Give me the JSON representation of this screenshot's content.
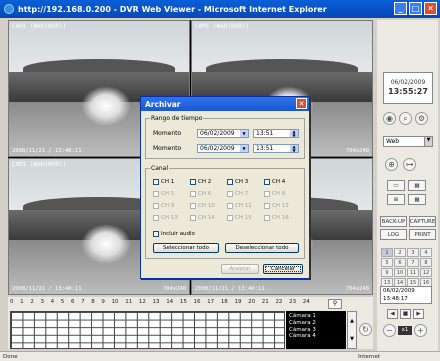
{
  "window": {
    "title": "http://192.168.0.200 - DVR Web Viewer - Microsoft Internet Explorer"
  },
  "cameras": [
    {
      "label": "CAM1 (Web(NVR))",
      "timestamp": "2008/11/21 / 13:40:11",
      "resolution": "704x240"
    },
    {
      "label": "CAM1 (Web(NVR))",
      "timestamp": "",
      "resolution": "704x240"
    },
    {
      "label": "CAM1 (Web(NVR))",
      "timestamp": "2008/11/21 / 13:40:11",
      "resolution": "704x240"
    },
    {
      "label": "",
      "timestamp": "2008/11/21 / 13:40:11",
      "resolution": "704x240"
    }
  ],
  "side": {
    "date": "06/02/2009",
    "time": "13:55:27",
    "mode_select": "Web",
    "backup": "BACK-UP",
    "capture": "CAPTURE",
    "log": "LOG",
    "print": "PRINT",
    "channels": [
      "1",
      "2",
      "3",
      "4",
      "5",
      "6",
      "7",
      "8",
      "9",
      "10",
      "11",
      "12",
      "13",
      "14",
      "15",
      "16"
    ],
    "search_date": "06/02/2009",
    "search_time": "13:48:17",
    "speed": "x1"
  },
  "timeline": {
    "hours": [
      "0",
      "1",
      "2",
      "3",
      "4",
      "5",
      "6",
      "7",
      "8",
      "9",
      "10",
      "11",
      "12",
      "13",
      "14",
      "15",
      "16",
      "17",
      "18",
      "19",
      "20",
      "21",
      "22",
      "23",
      "24"
    ],
    "cameras": [
      "Cámara 1",
      "Cámara 2",
      "Cámara 3",
      "Cámara 4"
    ]
  },
  "dialog": {
    "title": "Archivar",
    "time_range_label": "Rango de tiempo",
    "moment1_label": "Momento",
    "moment1_date": "06/02/2009",
    "moment1_time": "13:51",
    "moment2_label": "Momento",
    "moment2_date": "06/02/2009",
    "moment2_time": "13:51",
    "channel_label": "Canal",
    "channels": [
      "CH 1",
      "CH 2",
      "CH 3",
      "CH 4",
      "CH 5",
      "CH 6",
      "CH 7",
      "CH 8",
      "CH 9",
      "CH 10",
      "CH 11",
      "CH 12",
      "CH 13",
      "CH 14",
      "CH 15",
      "CH 16"
    ],
    "include_audio": "Incluir audio",
    "select_all": "Seleccionar todo",
    "deselect_all": "Deseleccionar todo",
    "accept": "Aceptar",
    "cancel": "Cancelar"
  },
  "status": {
    "left": "Done",
    "zone": "Internet"
  }
}
